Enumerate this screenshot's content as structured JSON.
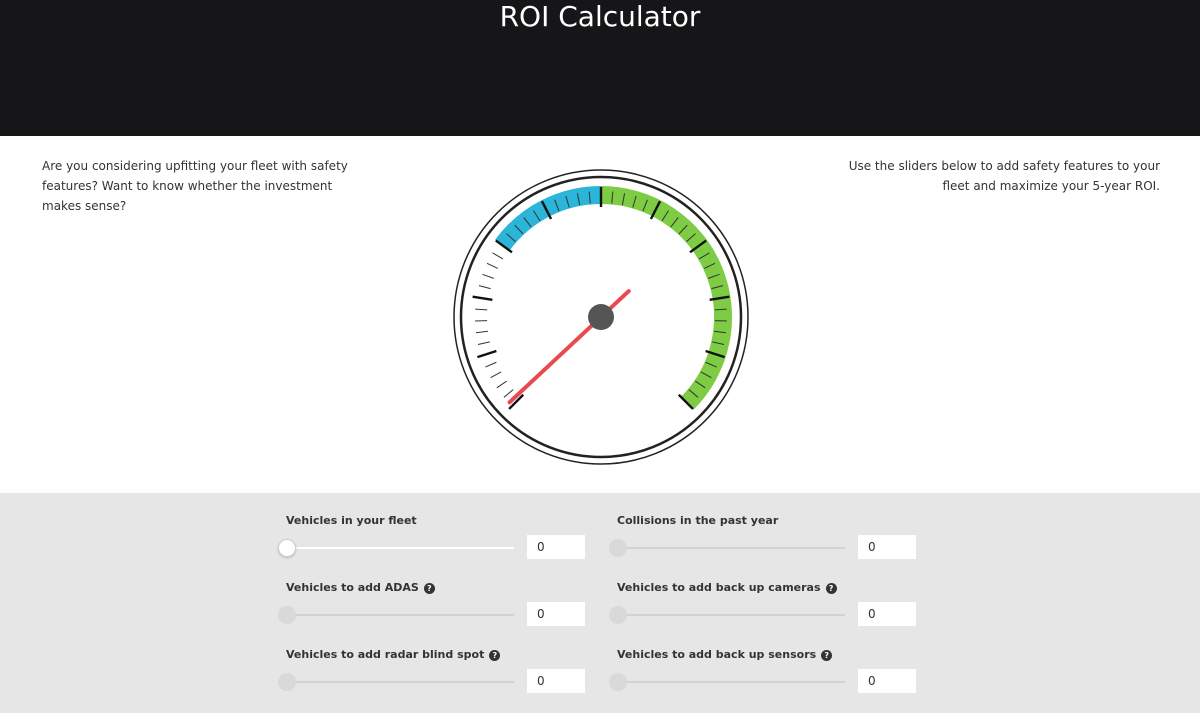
{
  "header": {
    "title": "ROI Calculator"
  },
  "intro": {
    "left": "Are you considering upfitting your fleet with safety features? Want to know whether the investment makes sense?",
    "right": "Use the sliders below to add safety features to your fleet and maximize your 5-year ROI."
  },
  "gauge": {
    "needle_value": 0,
    "colors": {
      "low_band": "#2bb5d8",
      "high_band": "#7ecb44",
      "needle": "#e94a4f",
      "hub": "#555555"
    }
  },
  "controls": [
    {
      "label": "Vehicles in your fleet",
      "value": "0",
      "has_help": false
    },
    {
      "label": "Collisions in the past year",
      "value": "0",
      "has_help": false
    },
    {
      "label": "Vehicles to add ADAS",
      "value": "0",
      "has_help": true
    },
    {
      "label": "Vehicles to add back up cameras",
      "value": "0",
      "has_help": true
    },
    {
      "label": "Vehicles to add radar blind spot",
      "value": "0",
      "has_help": true
    },
    {
      "label": "Vehicles to add back up sensors",
      "value": "0",
      "has_help": true
    }
  ],
  "icons": {
    "help": "?"
  }
}
